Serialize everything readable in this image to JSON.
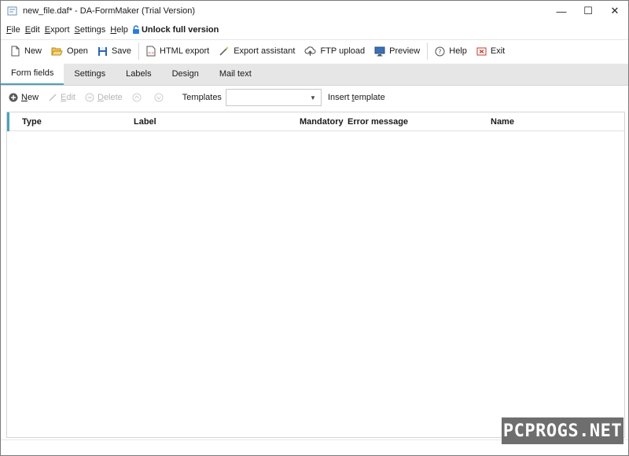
{
  "window": {
    "title": "new_file.daf* - DA-FormMaker (Trial Version)",
    "controls": [
      "—",
      "☐",
      "✕"
    ]
  },
  "menu": {
    "items": [
      {
        "first": "F",
        "rest": "ile"
      },
      {
        "first": "E",
        "rest": "dit"
      },
      {
        "first": "E",
        "rest": "xport"
      },
      {
        "first": "S",
        "rest": "ettings"
      },
      {
        "first": "H",
        "rest": "elp"
      }
    ],
    "unlock_label": "Unlock full version"
  },
  "toolbar": {
    "new": "New",
    "open": "Open",
    "save": "Save",
    "html_export": "HTML export",
    "export_assistant": "Export assistant",
    "ftp_upload": "FTP upload",
    "preview": "Preview",
    "help": "Help",
    "exit": "Exit"
  },
  "tabs": [
    "Form fields",
    "Settings",
    "Labels",
    "Design",
    "Mail text"
  ],
  "active_tab": 0,
  "subtoolbar": {
    "new": "N",
    "new_rest": "ew",
    "edit": "E",
    "edit_rest": "dit",
    "delete": "D",
    "delete_rest": "elete",
    "templates_label": "Templates",
    "templates_value": "",
    "insert_template_a": "Insert ",
    "insert_template_u": "t",
    "insert_template_b": "emplate"
  },
  "grid": {
    "columns": [
      "Type",
      "Label",
      "Mandatory",
      "Error message",
      "Name"
    ],
    "rows": []
  },
  "watermark": "PCPROGS.NET",
  "colors": {
    "accent": "#4aa3b8",
    "tabstrip_bg": "#e6e6e6",
    "disabled_text": "#b5b5b5"
  }
}
